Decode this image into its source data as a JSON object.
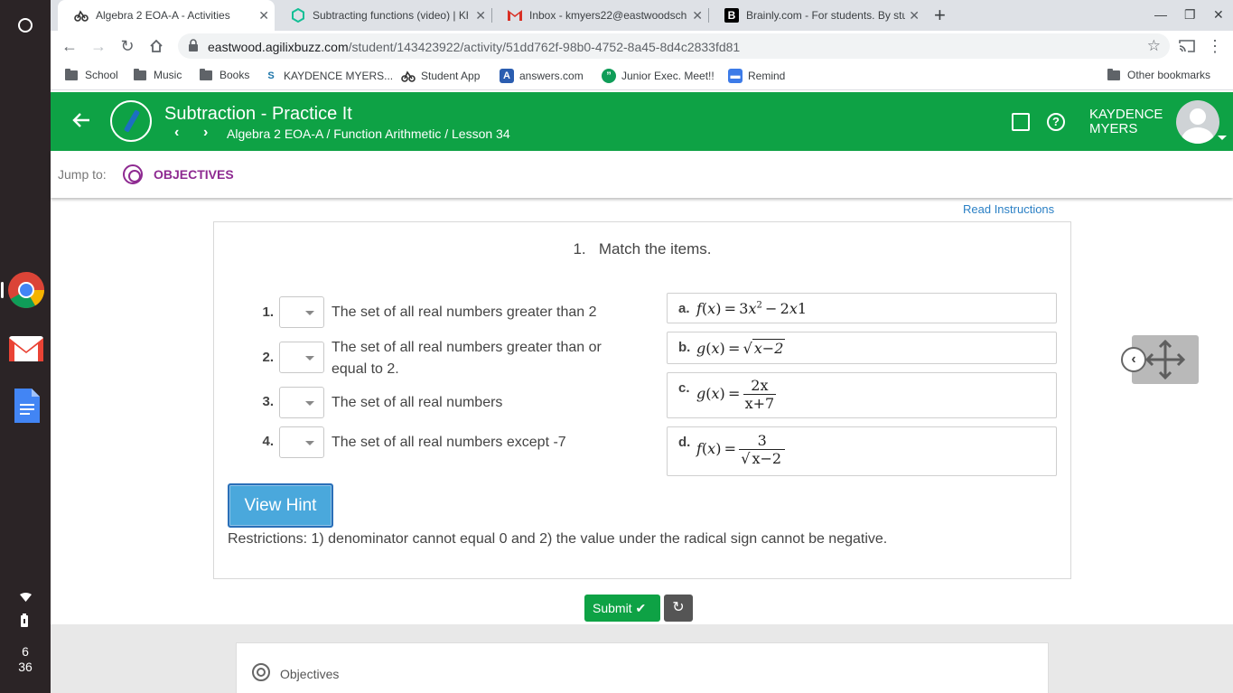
{
  "shelf": {
    "clock_hour": "6",
    "clock_minute": "36"
  },
  "tabs": [
    {
      "title": "Algebra 2 EOA-A - Activities",
      "icon": "agilix-icon"
    },
    {
      "title": "Subtracting functions (video) | Kh",
      "icon": "khan-academy-icon"
    },
    {
      "title": "Inbox - kmyers22@eastwoodsch",
      "icon": "gmail-icon"
    },
    {
      "title": "Brainly.com - For students. By stu",
      "icon": "brainly-icon"
    }
  ],
  "address": {
    "domain": "eastwood.agilixbuzz.com",
    "path": "/student/143423922/activity/51dd762f-98b0-4752-8a45-8d4c2833fd81"
  },
  "bookmarks": [
    "School",
    "Music",
    "Books",
    "KAYDENCE MYERS...",
    "Student App",
    "answers.com",
    "Junior Exec. Meet!!",
    "Remind"
  ],
  "other_bookmarks": "Other bookmarks",
  "header": {
    "title": "Subtraction - Practice It",
    "breadcrumb": "Algebra 2 EOA-A / Function Arithmetic / Lesson 34",
    "user_first": "KAYDENCE",
    "user_last": "MYERS"
  },
  "jump": {
    "label": "Jump to:",
    "objectives": "OBJECTIVES"
  },
  "read_instructions": "Read Instructions",
  "question": {
    "number": "1.",
    "prompt": "Match the items.",
    "items": [
      {
        "num": "1.",
        "text": "The set of all real numbers greater than 2"
      },
      {
        "num": "2.",
        "text": "The set of all real numbers greater than or equal to 2."
      },
      {
        "num": "3.",
        "text": "The set of all real numbers"
      },
      {
        "num": "4.",
        "text": "The set of all real numbers except -7"
      }
    ],
    "options": [
      {
        "letter": "a.",
        "fn": "f",
        "var": "x",
        "coef1": "3",
        "exp": "2",
        "rest": "2",
        "tail": "1"
      },
      {
        "letter": "b.",
        "fn": "g",
        "var": "x",
        "radicand": "x−2"
      },
      {
        "letter": "c.",
        "fn": "g",
        "var": "x",
        "numerator": "2x",
        "denominator": "x+7"
      },
      {
        "letter": "d.",
        "fn": "f",
        "var": "x",
        "numerator": "3",
        "denominator": "x−2"
      }
    ],
    "hint_button": "View Hint",
    "hint_text": "Restrictions: 1) denominator cannot equal 0 and 2) the value under the radical sign cannot be negative.",
    "submit": "Submit",
    "submit_check": "✔"
  },
  "objectives_panel": {
    "title": "Objectives"
  }
}
